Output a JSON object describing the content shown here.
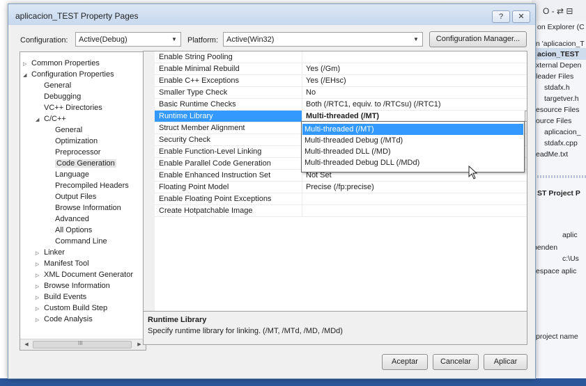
{
  "background": {
    "top_icons": "O - ⇄ ⊟",
    "lines": [
      {
        "text": "on Explorer (C",
        "bold": false
      },
      {
        "text": "n 'aplicacion_T",
        "bold": false
      },
      {
        "text": "acion_TEST",
        "bold": true
      },
      {
        "text": "xternal Depen",
        "bold": false
      },
      {
        "text": "leader Files",
        "bold": false
      },
      {
        "text": "stdafx.h",
        "bold": false
      },
      {
        "text": "targetver.h",
        "bold": false
      },
      {
        "text": "esource Files",
        "bold": false
      },
      {
        "text": "ource Files",
        "bold": false
      },
      {
        "text": "aplicacion_",
        "bold": false
      },
      {
        "text": "stdafx.cpp",
        "bold": false
      },
      {
        "text": "eadMe.txt",
        "bold": false
      },
      {
        "text": "ST Project P",
        "bold": true
      },
      {
        "text": "aplic",
        "bold": false
      },
      {
        "text": "penden",
        "bold": false
      },
      {
        "text": "c:\\Us",
        "bold": false
      },
      {
        "text": "espace aplic",
        "bold": false
      },
      {
        "text": "project name",
        "bold": false
      }
    ]
  },
  "dialog": {
    "title": "aplicacion_TEST Property Pages",
    "help_label": "?",
    "close_label": "✕",
    "configuration_label": "Configuration:",
    "configuration_value": "Active(Debug)",
    "platform_label": "Platform:",
    "platform_value": "Active(Win32)",
    "config_manager_label": "Configuration Manager...",
    "ok_label": "Aceptar",
    "cancel_label": "Cancelar",
    "apply_label": "Aplicar"
  },
  "tree": [
    {
      "label": "Common Properties",
      "level": 0,
      "state": "collapsed"
    },
    {
      "label": "Configuration Properties",
      "level": 0,
      "state": "expanded"
    },
    {
      "label": "General",
      "level": 1,
      "state": "leaf"
    },
    {
      "label": "Debugging",
      "level": 1,
      "state": "leaf"
    },
    {
      "label": "VC++ Directories",
      "level": 1,
      "state": "leaf"
    },
    {
      "label": "C/C++",
      "level": 1,
      "state": "expanded"
    },
    {
      "label": "General",
      "level": 2,
      "state": "leaf"
    },
    {
      "label": "Optimization",
      "level": 2,
      "state": "leaf"
    },
    {
      "label": "Preprocessor",
      "level": 2,
      "state": "leaf"
    },
    {
      "label": "Code Generation",
      "level": 2,
      "state": "leaf",
      "selected": true
    },
    {
      "label": "Language",
      "level": 2,
      "state": "leaf"
    },
    {
      "label": "Precompiled Headers",
      "level": 2,
      "state": "leaf"
    },
    {
      "label": "Output Files",
      "level": 2,
      "state": "leaf"
    },
    {
      "label": "Browse Information",
      "level": 2,
      "state": "leaf"
    },
    {
      "label": "Advanced",
      "level": 2,
      "state": "leaf"
    },
    {
      "label": "All Options",
      "level": 2,
      "state": "leaf"
    },
    {
      "label": "Command Line",
      "level": 2,
      "state": "leaf"
    },
    {
      "label": "Linker",
      "level": 1,
      "state": "collapsed"
    },
    {
      "label": "Manifest Tool",
      "level": 1,
      "state": "collapsed"
    },
    {
      "label": "XML Document Generator",
      "level": 1,
      "state": "collapsed"
    },
    {
      "label": "Browse Information",
      "level": 1,
      "state": "collapsed"
    },
    {
      "label": "Build Events",
      "level": 1,
      "state": "collapsed"
    },
    {
      "label": "Custom Build Step",
      "level": 1,
      "state": "collapsed"
    },
    {
      "label": "Code Analysis",
      "level": 1,
      "state": "collapsed"
    }
  ],
  "tree_scroll_grip": "III",
  "properties": [
    {
      "name": "Enable String Pooling",
      "value": ""
    },
    {
      "name": "Enable Minimal Rebuild",
      "value": "Yes (/Gm)"
    },
    {
      "name": "Enable C++ Exceptions",
      "value": "Yes (/EHsc)"
    },
    {
      "name": "Smaller Type Check",
      "value": "No"
    },
    {
      "name": "Basic Runtime Checks",
      "value": "Both (/RTC1, equiv. to /RTCsu) (/RTC1)"
    },
    {
      "name": "Runtime Library",
      "value": "Multi-threaded (/MT)",
      "selected": true
    },
    {
      "name": "Struct Member Alignment",
      "value": ""
    },
    {
      "name": "Security Check",
      "value": ""
    },
    {
      "name": "Enable Function-Level Linking",
      "value": ""
    },
    {
      "name": "Enable Parallel Code Generation",
      "value": ""
    },
    {
      "name": "Enable Enhanced Instruction Set",
      "value": "Not Set"
    },
    {
      "name": "Floating Point Model",
      "value": "Precise (/fp:precise)"
    },
    {
      "name": "Enable Floating Point Exceptions",
      "value": ""
    },
    {
      "name": "Create Hotpatchable Image",
      "value": ""
    }
  ],
  "runtime_options": [
    {
      "label": "Multi-threaded (/MT)",
      "highlighted": true
    },
    {
      "label": "Multi-threaded Debug (/MTd)",
      "highlighted": false
    },
    {
      "label": "Multi-threaded DLL (/MD)",
      "highlighted": false
    },
    {
      "label": "Multi-threaded Debug DLL (/MDd)",
      "highlighted": false
    }
  ],
  "description": {
    "title": "Runtime Library",
    "text": "Specify runtime library for linking.     (/MT, /MTd, /MD, /MDd)"
  },
  "colors": {
    "selection": "#3399ff",
    "accent_bar": "#2b579a"
  }
}
